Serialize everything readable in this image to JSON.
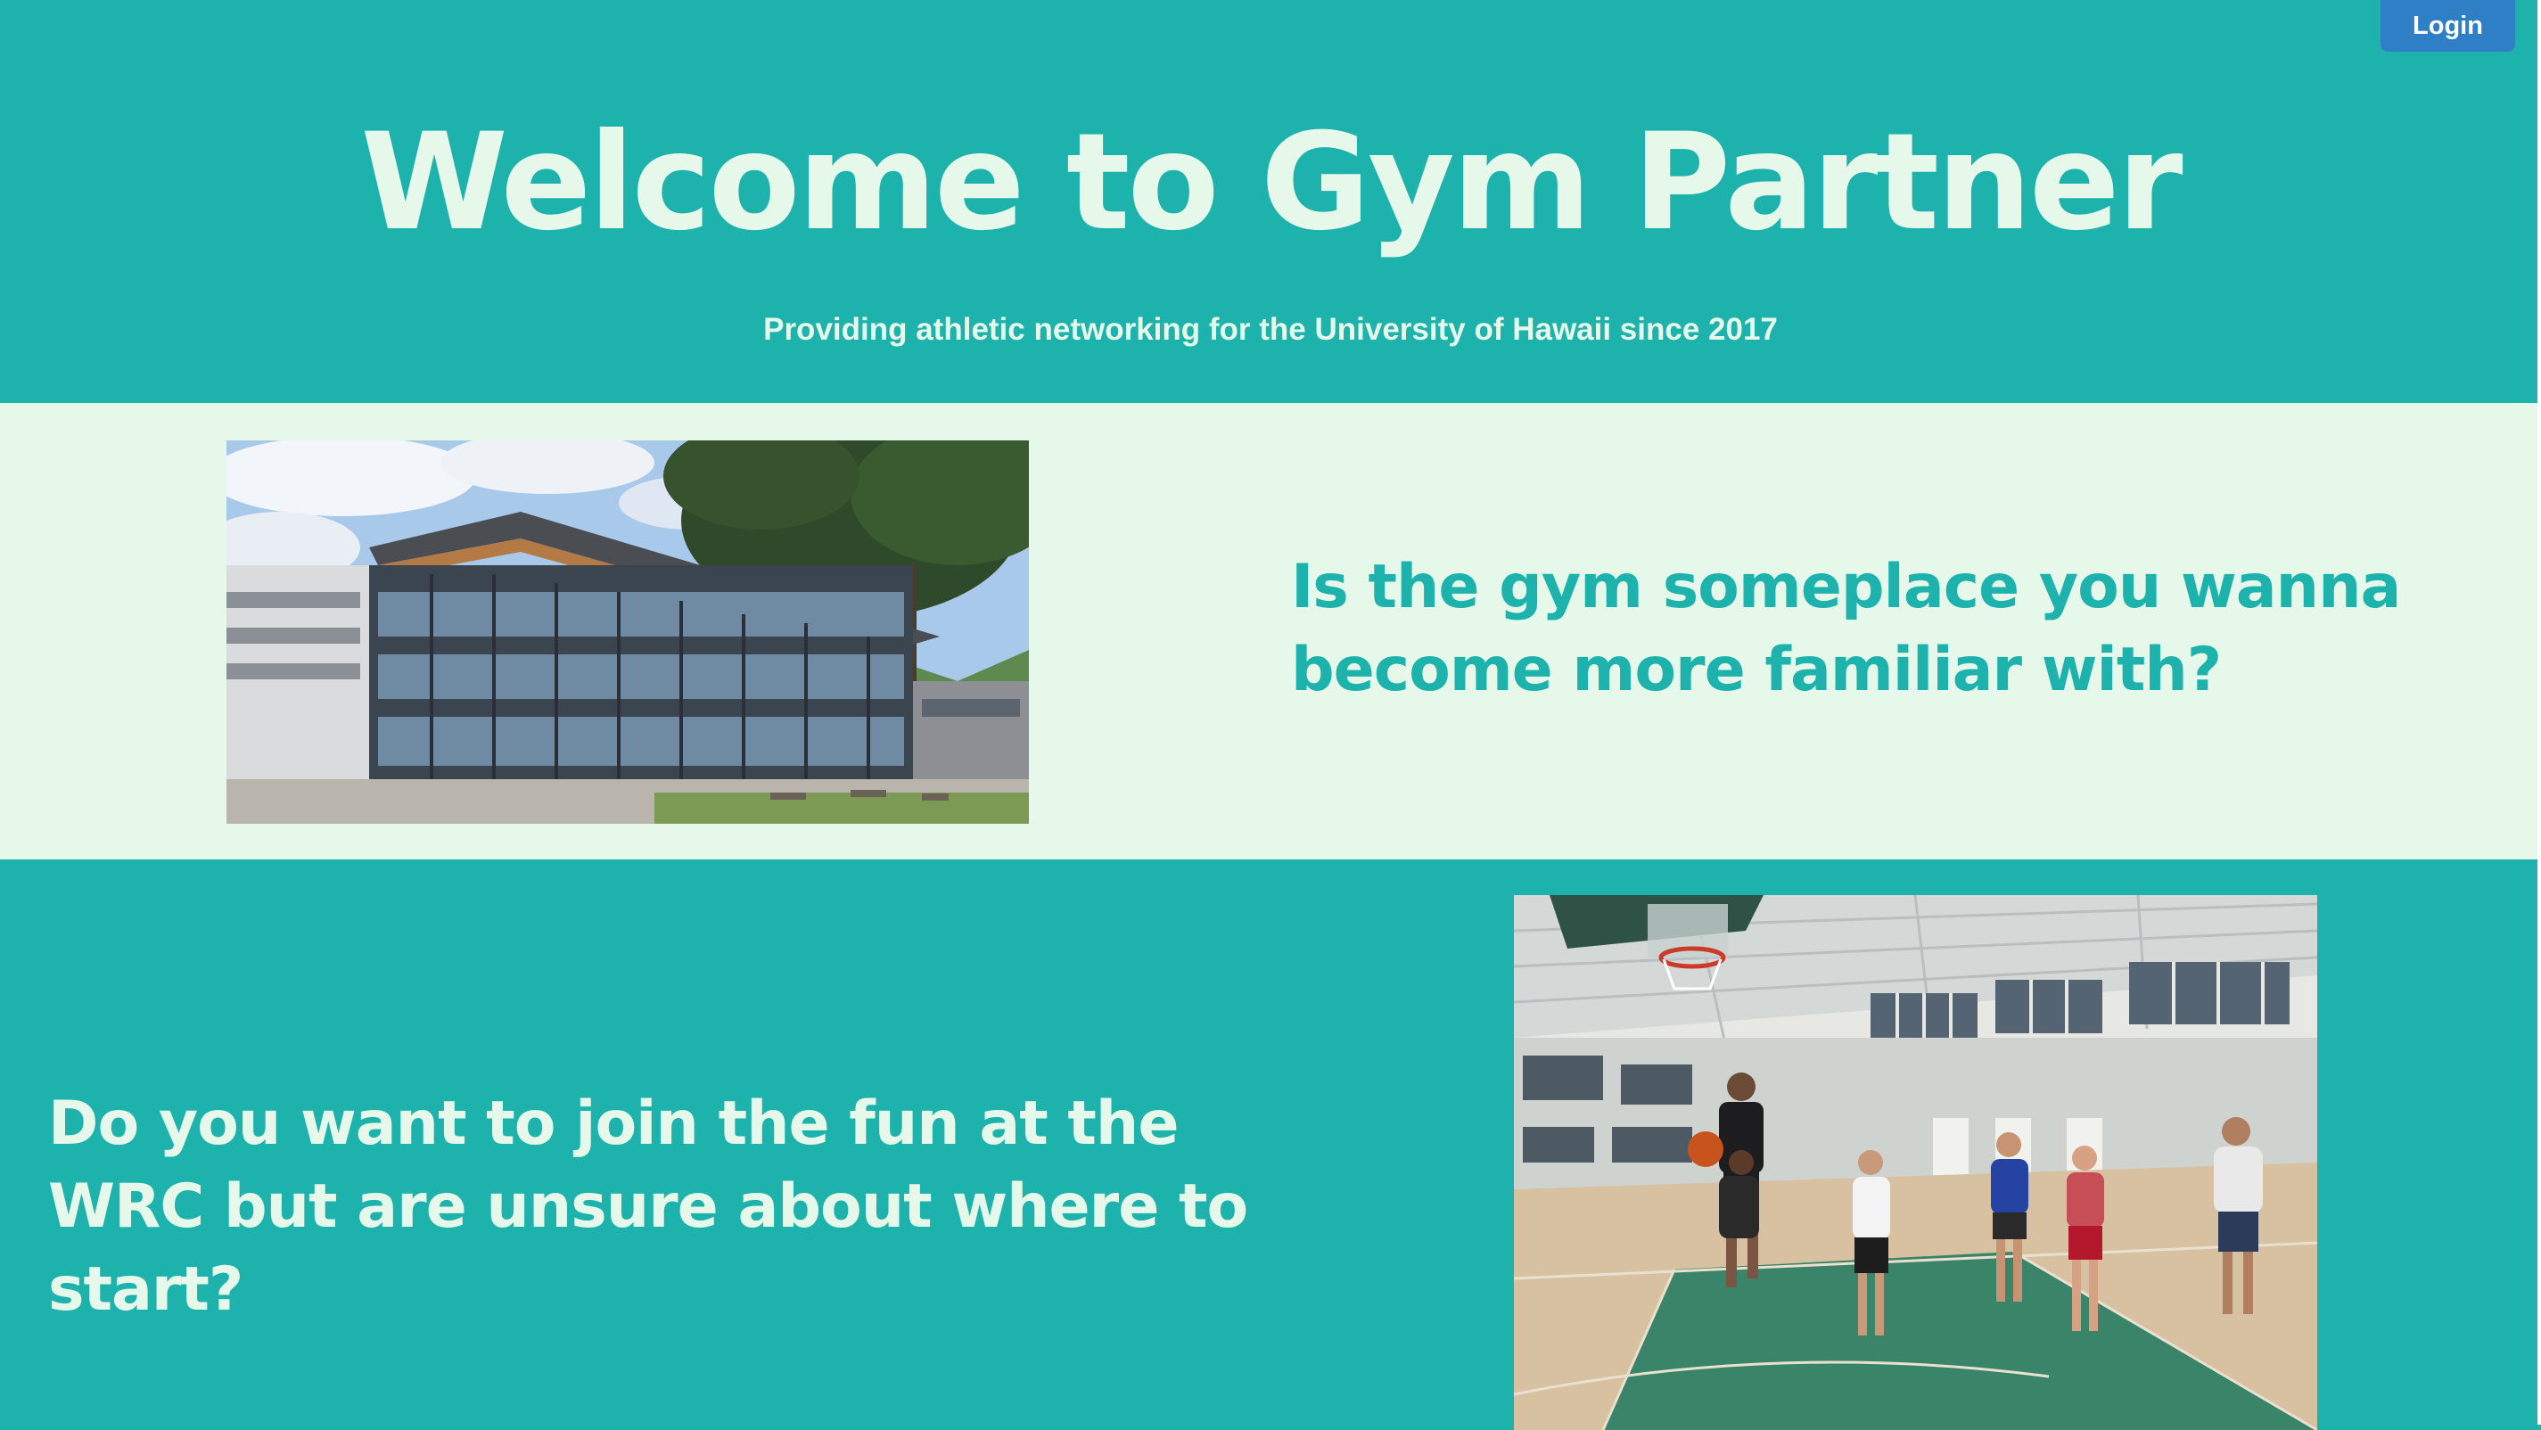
{
  "header": {
    "login_label": "Login"
  },
  "hero": {
    "title": "Welcome to Gym Partner",
    "subtitle": "Providing athletic networking for the University of Hawaii since 2017"
  },
  "section_gym": {
    "question": "Is the gym someplace you wanna become more familiar with?"
  },
  "section_wrc": {
    "question": "Do you want to join the fun at the WRC but are unsure about where to start?"
  },
  "colors": {
    "teal": "#1db3ac",
    "mint": "#e6f8e9",
    "login_blue": "#2e7fc6"
  }
}
